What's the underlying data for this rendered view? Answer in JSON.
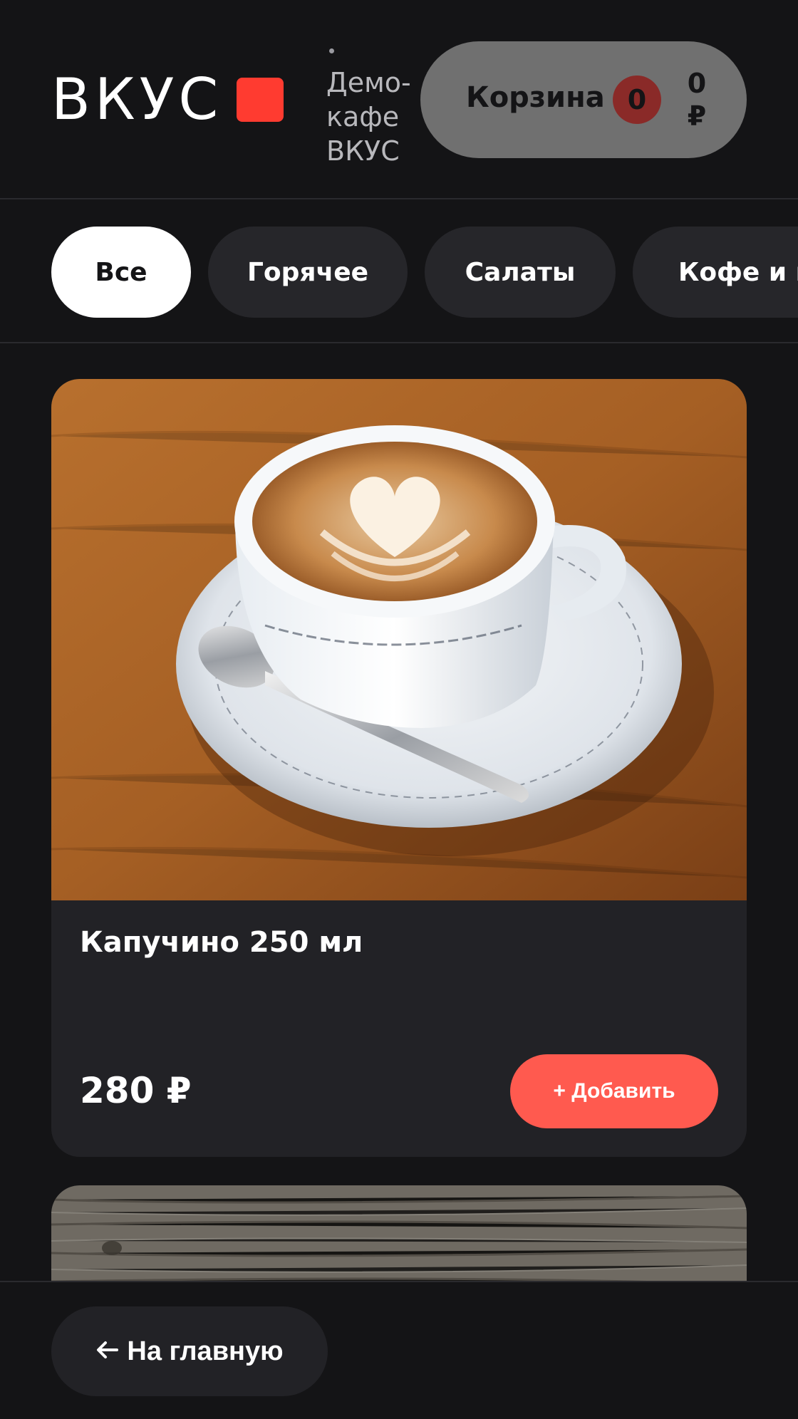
{
  "header": {
    "logo_text": "ВКУС",
    "cafe_name": "Демо-кафе ВКУС",
    "cart": {
      "label": "Корзина",
      "count": "0",
      "total_amount": "0",
      "currency": "₽"
    }
  },
  "categories": [
    {
      "label": "Все",
      "active": true
    },
    {
      "label": "Горячее",
      "active": false
    },
    {
      "label": "Салаты",
      "active": false
    },
    {
      "label": "Кофе и н",
      "active": false
    }
  ],
  "products": [
    {
      "name": "Капучино 250 мл",
      "price": "280 ₽",
      "add_label": "+ Добавить",
      "image": "cappuccino-photo"
    }
  ],
  "bottom": {
    "home_label": "На главную",
    "home_icon": "arrow-left-icon"
  },
  "colors": {
    "accent": "#ff3b30",
    "add_button": "#ff5a4f",
    "background": "#141416",
    "card": "#222226",
    "chip": "#26262a",
    "cart_pill": "#707070"
  }
}
